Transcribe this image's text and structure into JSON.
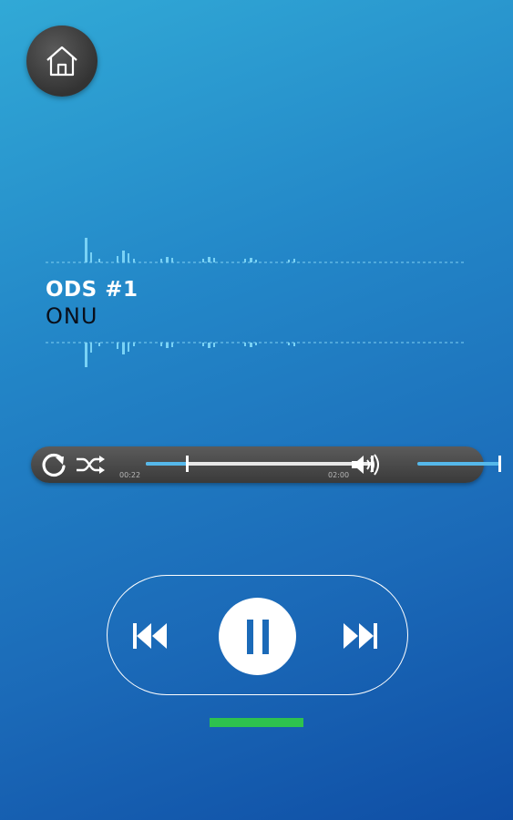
{
  "header": {
    "home_icon": "home-icon"
  },
  "track": {
    "title": "ODS #1",
    "artist": "ONU"
  },
  "player": {
    "elapsed": "00:22",
    "duration": "02:00",
    "progress_fraction": 0.18,
    "volume_fraction": 1.0,
    "icons": {
      "repeat": "repeat-icon",
      "shuffle": "shuffle-icon",
      "volume": "volume-icon",
      "previous": "previous-icon",
      "pause": "pause-icon",
      "next": "next-icon"
    }
  },
  "colors": {
    "accent": "#55b8ea",
    "indicator": "#2ec24e"
  }
}
